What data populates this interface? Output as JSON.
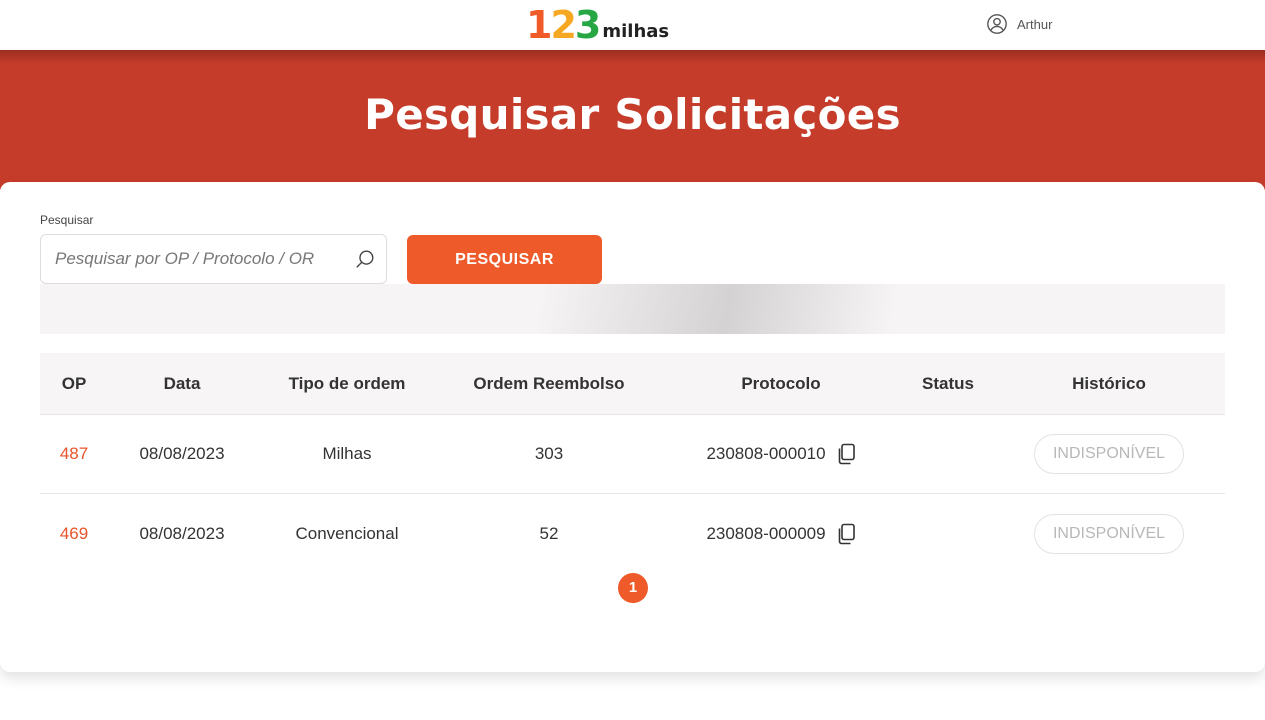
{
  "header": {
    "logo": {
      "digit1": "1",
      "digit2": "2",
      "digit3": "3",
      "word": "milhas",
      "colors": [
        "#f05a28",
        "#f7a823",
        "#27a744"
      ]
    },
    "user": {
      "icon": "user-circle-icon",
      "name": "Arthur"
    }
  },
  "banner": {
    "title": "Pesquisar Solicitações",
    "color": "#c63c2a"
  },
  "search": {
    "label": "Pesquisar",
    "placeholder": "Pesquisar por OP / Protocolo / OR",
    "value": "",
    "icon": "search-icon",
    "button_label": "PESQUISAR"
  },
  "table": {
    "columns": [
      "OP",
      "Data",
      "Tipo de ordem",
      "Ordem Reembolso",
      "Protocolo",
      "Status",
      "Histórico"
    ],
    "rows": [
      {
        "op": "487",
        "data": "08/08/2023",
        "tipo": "Milhas",
        "reembolso": "303",
        "protocolo": "230808-000010",
        "status": "",
        "historico": "INDISPONÍVEL"
      },
      {
        "op": "469",
        "data": "08/08/2023",
        "tipo": "Convencional",
        "reembolso": "52",
        "protocolo": "230808-000009",
        "status": "",
        "historico": "INDISPONÍVEL"
      }
    ]
  },
  "pagination": {
    "current": "1"
  },
  "accent_color": "#ef5a2a"
}
